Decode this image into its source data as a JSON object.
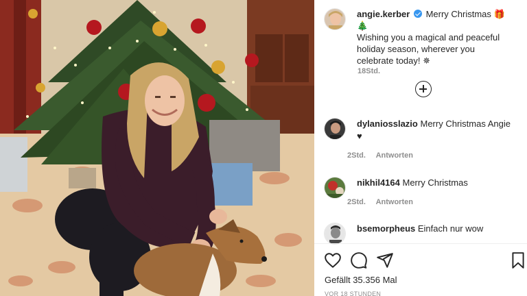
{
  "post": {
    "author": "angie.kerber",
    "caption_line1": "Merry Christmas 🎁🎄",
    "caption_rest": "Wishing you a magical and peaceful holiday season, wherever you celebrate today! ✵",
    "time": "18Std."
  },
  "comments": [
    {
      "user": "dylaniosslazio",
      "text": "Merry Christmas Angie",
      "extra": "♥",
      "time": "2Std.",
      "reply": "Antworten"
    },
    {
      "user": "nikhil4164",
      "text": "Merry Christmas",
      "time": "2Std.",
      "reply": "Antworten"
    },
    {
      "user": "bsemorpheus",
      "text": "Einfach nur wow"
    }
  ],
  "footer": {
    "likes_prefix": "Gefällt",
    "likes_count": "35.356",
    "likes_suffix": "Mal",
    "posted_ago": "VOR 18 STUNDEN"
  },
  "icons": {
    "like": "heart-icon",
    "comment": "comment-icon",
    "share": "share-icon",
    "save": "bookmark-icon",
    "load_more": "plus-circle-icon",
    "verified": "verified-badge-icon"
  },
  "colors": {
    "text": "#262626",
    "muted": "#8e8e8e",
    "verified": "#3897f0",
    "divider": "#efefef"
  }
}
